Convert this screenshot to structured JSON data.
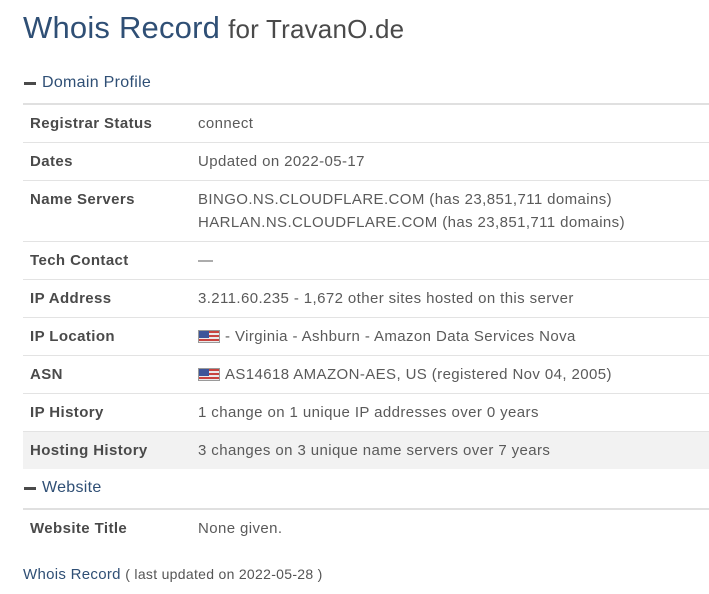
{
  "heading": {
    "main": "Whois Record",
    "rest": "for TravanO.de"
  },
  "domain_profile": {
    "title": "Domain Profile",
    "rows": [
      {
        "label": "Registrar Status",
        "value": "connect"
      },
      {
        "label": "Dates",
        "value": "Updated on 2022-05-17"
      },
      {
        "label": "Name Servers",
        "value_lines": [
          "BINGO.NS.CLOUDFLARE.COM (has 23,851,711 domains)",
          "HARLAN.NS.CLOUDFLARE.COM (has 23,851,711 domains)"
        ]
      },
      {
        "label": "Tech Contact",
        "value": "—"
      },
      {
        "label": "IP Address",
        "value": "3.211.60.235 - 1,672 other sites hosted on this server"
      },
      {
        "label": "IP Location",
        "value": "- Virginia - Ashburn - Amazon Data Services Nova",
        "flag_icon": "us-flag-icon"
      },
      {
        "label": "ASN",
        "value": "AS14618 AMAZON-AES, US (registered Nov 04, 2005)",
        "flag_icon": "us-flag-icon"
      },
      {
        "label": "IP History",
        "value": "1 change on 1 unique IP addresses over 0 years"
      },
      {
        "label": "Hosting History",
        "value": "3 changes on 3 unique name servers over 7 years"
      }
    ]
  },
  "website": {
    "title": "Website",
    "rows": [
      {
        "label": "Website Title",
        "value": "None given."
      }
    ]
  },
  "footer": {
    "link": "Whois Record",
    "updated": "( last updated on 2022-05-28 )"
  },
  "colors": {
    "accent": "#2f4f75",
    "text": "#4a4a4a",
    "row_shade": "#f2f2f2"
  }
}
